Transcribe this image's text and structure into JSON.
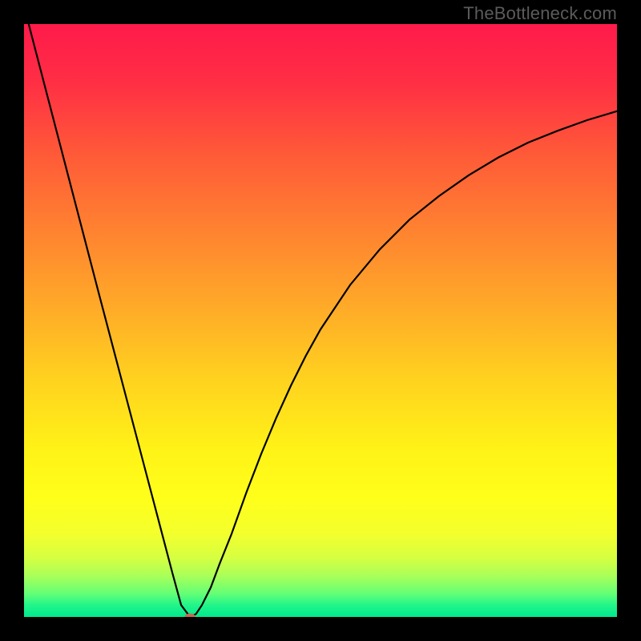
{
  "watermark": {
    "text": "TheBottleneck.com"
  },
  "chart_data": {
    "type": "line",
    "title": "",
    "xlabel": "",
    "ylabel": "",
    "xlim": [
      0,
      100
    ],
    "ylim": [
      0,
      100
    ],
    "series": [
      {
        "name": "bottleneck-curve",
        "x": [
          0.0,
          2.5,
          5.0,
          7.5,
          10.0,
          12.5,
          15.0,
          17.5,
          20.0,
          22.5,
          25.0,
          26.5,
          28.0,
          29.0,
          30.0,
          31.5,
          33.0,
          35.0,
          37.5,
          40.0,
          42.5,
          45.0,
          47.5,
          50.0,
          55.0,
          60.0,
          65.0,
          70.0,
          75.0,
          80.0,
          85.0,
          90.0,
          95.0,
          100.0
        ],
        "values": [
          103.0,
          93.4,
          83.8,
          74.2,
          64.6,
          55.0,
          45.5,
          36.0,
          26.5,
          17.0,
          7.5,
          2.0,
          0.0,
          0.5,
          2.0,
          5.0,
          9.0,
          14.0,
          21.0,
          27.5,
          33.5,
          39.0,
          44.0,
          48.5,
          56.0,
          62.0,
          67.0,
          71.0,
          74.5,
          77.5,
          80.0,
          82.0,
          83.8,
          85.3
        ]
      }
    ],
    "marker": {
      "x": 28.0,
      "y": 0.0,
      "rx": 0.9,
      "ry": 0.6,
      "name": "optimal-point"
    },
    "gradient_stops": [
      {
        "offset": 0,
        "color": "#ff1a4b"
      },
      {
        "offset": 10,
        "color": "#ff2f44"
      },
      {
        "offset": 22,
        "color": "#ff5a38"
      },
      {
        "offset": 35,
        "color": "#ff8330"
      },
      {
        "offset": 48,
        "color": "#ffab28"
      },
      {
        "offset": 60,
        "color": "#ffd21f"
      },
      {
        "offset": 72,
        "color": "#fff317"
      },
      {
        "offset": 80,
        "color": "#ffff1a"
      },
      {
        "offset": 86,
        "color": "#f3ff2d"
      },
      {
        "offset": 90,
        "color": "#d6ff41"
      },
      {
        "offset": 93,
        "color": "#aaff58"
      },
      {
        "offset": 96,
        "color": "#66ff76"
      },
      {
        "offset": 98,
        "color": "#22f58a"
      },
      {
        "offset": 100,
        "color": "#00e98e"
      }
    ]
  }
}
